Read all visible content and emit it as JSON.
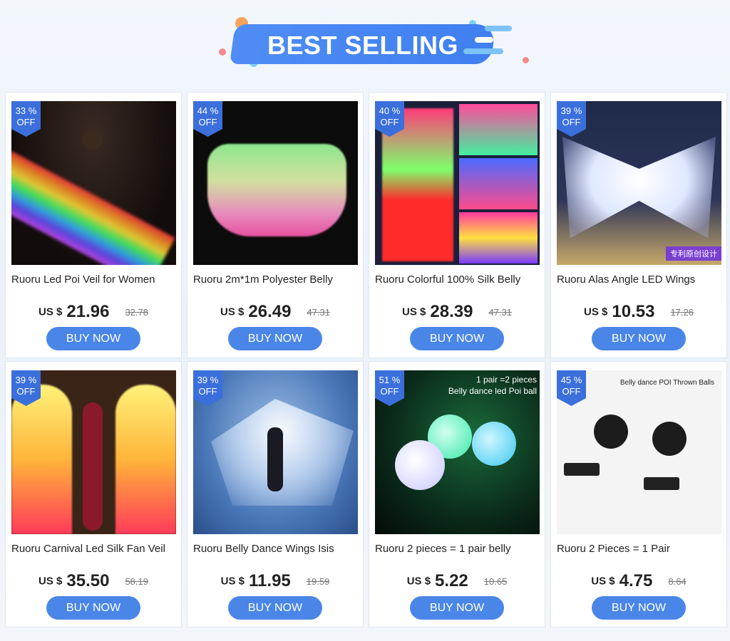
{
  "header": {
    "title": "BEST SELLING"
  },
  "products": [
    {
      "discount_value": "33 %",
      "discount_label": "OFF",
      "title": "Ruoru Led Poi Veil for Women",
      "currency": "US $",
      "price": "21.96",
      "old_price": "32.78",
      "button": "BUY NOW"
    },
    {
      "discount_value": "44 %",
      "discount_label": "OFF",
      "title": "Ruoru 2m*1m Polyester Belly",
      "currency": "US $",
      "price": "26.49",
      "old_price": "47.31",
      "button": "BUY NOW"
    },
    {
      "discount_value": "40 %",
      "discount_label": "OFF",
      "title": "Ruoru Colorful 100% Silk Belly",
      "currency": "US $",
      "price": "28.39",
      "old_price": "47.31",
      "button": "BUY NOW"
    },
    {
      "discount_value": "39 %",
      "discount_label": "OFF",
      "title": "Ruoru Alas Angle LED Wings",
      "currency": "US $",
      "price": "10.53",
      "old_price": "17.26",
      "button": "BUY NOW",
      "image_tag": "专利原创设计"
    },
    {
      "discount_value": "39 %",
      "discount_label": "OFF",
      "title": "Ruoru Carnival Led Silk Fan Veil",
      "currency": "US $",
      "price": "35.50",
      "old_price": "58.19",
      "button": "BUY NOW"
    },
    {
      "discount_value": "39 %",
      "discount_label": "OFF",
      "title": "Ruoru Belly Dance Wings Isis",
      "currency": "US $",
      "price": "11.95",
      "old_price": "19.59",
      "button": "BUY NOW"
    },
    {
      "discount_value": "51 %",
      "discount_label": "OFF",
      "title": "Ruoru 2 pieces = 1 pair belly",
      "currency": "US $",
      "price": "5.22",
      "old_price": "10.65",
      "button": "BUY NOW",
      "image_caption_1": "1 pair =2 pieces",
      "image_caption_2": "Belly dance led Poi ball"
    },
    {
      "discount_value": "45 %",
      "discount_label": "OFF",
      "title": "Ruoru 2 Pieces = 1 Pair",
      "currency": "US $",
      "price": "4.75",
      "old_price": "8.64",
      "button": "BUY NOW",
      "image_caption_1": "Belly dance POI Thrown Balls"
    }
  ],
  "colors": {
    "accent": "#4a86e8",
    "badge": "#3b6fdc",
    "banner": "#4f8df5"
  }
}
